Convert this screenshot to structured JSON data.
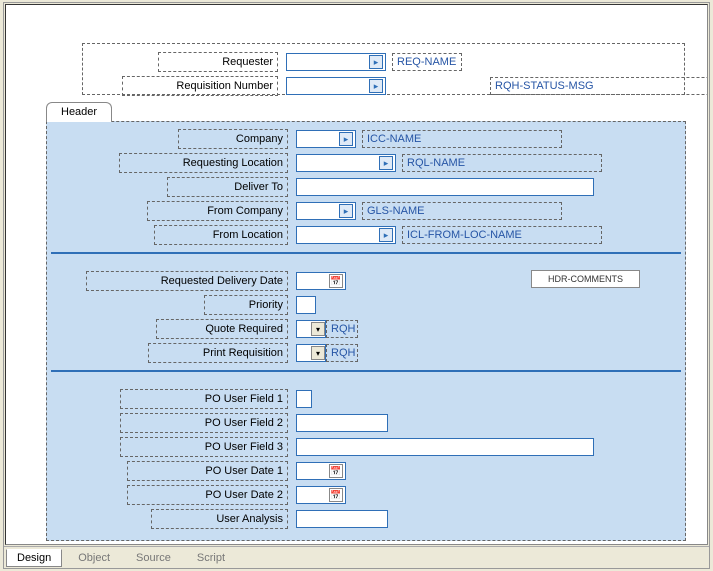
{
  "top": {
    "requester": {
      "label": "Requester",
      "display": "REQ-NAME"
    },
    "req_number": {
      "label": "Requisition Number",
      "display": "RQH-STATUS-MSG"
    }
  },
  "tab_label": "Header",
  "section1": {
    "company": {
      "label": "Company",
      "display": "ICC-NAME"
    },
    "req_loc": {
      "label": "Requesting Location",
      "display": "RQL-NAME"
    },
    "deliver_to": {
      "label": "Deliver To"
    },
    "from_company": {
      "label": "From Company",
      "display": "GLS-NAME"
    },
    "from_loc": {
      "label": "From Location",
      "display": "ICL-FROM-LOC-NAME"
    }
  },
  "section2": {
    "req_date": {
      "label": "Requested Delivery Date"
    },
    "priority": {
      "label": "Priority"
    },
    "quote_req": {
      "label": "Quote Required",
      "suffix": "RQH"
    },
    "print_req": {
      "label": "Print Requisition",
      "suffix": "RQH"
    },
    "comments_btn": "HDR-COMMENTS"
  },
  "section3": {
    "uf1": {
      "label": "PO User Field 1"
    },
    "uf2": {
      "label": "PO User Field 2"
    },
    "uf3": {
      "label": "PO User Field 3"
    },
    "ud1": {
      "label": "PO User Date 1"
    },
    "ud2": {
      "label": "PO User Date 2"
    },
    "uanal": {
      "label": "User Analysis"
    }
  },
  "footer": {
    "design": "Design",
    "object": "Object",
    "source": "Source",
    "script": "Script"
  }
}
